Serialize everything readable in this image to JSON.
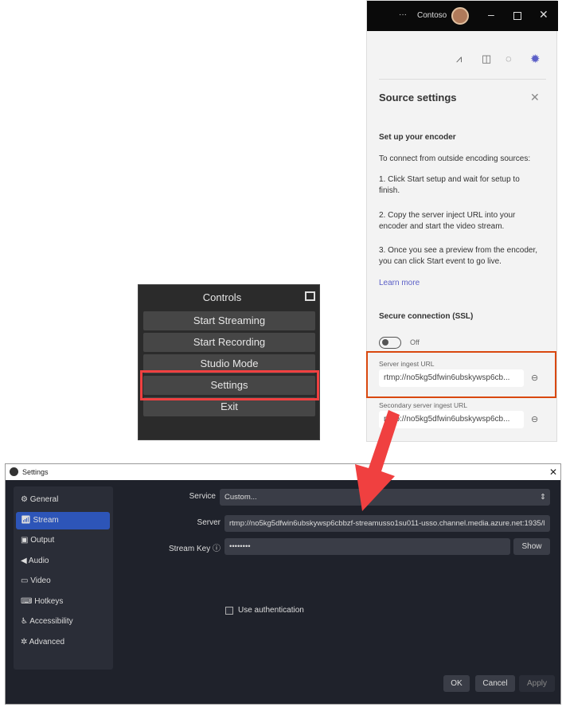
{
  "teams": {
    "more": "···",
    "org": "Contoso",
    "title": "Source settings",
    "section": "Set up your encoder",
    "intro": "To connect from outside encoding sources:",
    "steps": [
      "1. Click Start setup and wait for setup to finish.",
      "2. Copy the server inject URL into your encoder and start the video stream.",
      "3. Once you see a preview from the encoder, you can click Start event to go live."
    ],
    "learn_more": "Learn more",
    "ssl_label": "Secure connection (SSL)",
    "ssl_state": "Off",
    "server_label": "Server ingest URL",
    "server_value": "rtmp://no5kg5dfwin6ubskywsp6cb...",
    "secondary_label": "Secondary server ingest URL",
    "secondary_value": "rtmp://no5kg5dfwin6ubskywsp6cb...",
    "accent": "#5b5fc7",
    "highlight": "#d9480f"
  },
  "controls": {
    "title": "Controls",
    "buttons": [
      "Start Streaming",
      "Start Recording",
      "Studio Mode",
      "Settings",
      "Exit"
    ]
  },
  "settings": {
    "title": "Settings",
    "sidebar": [
      "General",
      "Stream",
      "Output",
      "Audio",
      "Video",
      "Hotkeys",
      "Accessibility",
      "Advanced"
    ],
    "selected": "Stream",
    "service_label": "Service",
    "service_value": "Custom...",
    "server_label": "Server",
    "server_value": "rtmp://no5kg5dfwin6ubskywsp6cbbzf-streamusso1su011-usso.channel.media.azure.net:1935/l",
    "key_label": "Stream Key",
    "key_value": "••••••••",
    "show": "Show",
    "auth": "Use authentication",
    "ok": "OK",
    "cancel": "Cancel",
    "apply": "Apply"
  },
  "annotation_color": "#f04040"
}
